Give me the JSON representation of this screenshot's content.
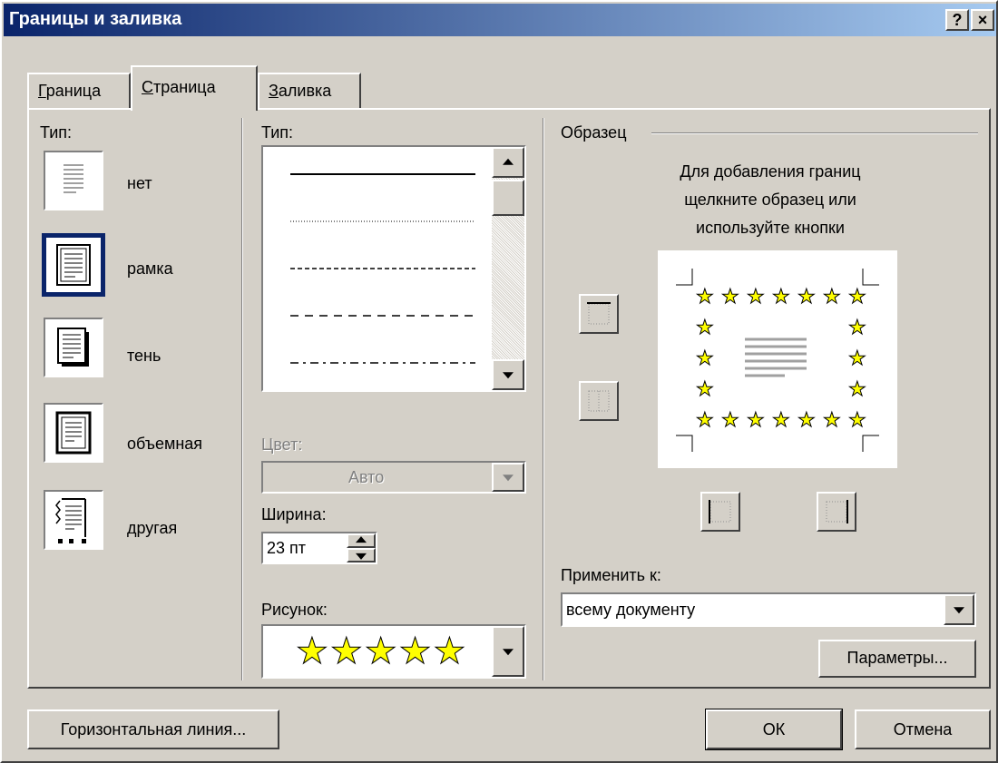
{
  "window": {
    "title": "Границы и заливка",
    "help_label": "?",
    "close_label": "×"
  },
  "tabs": [
    {
      "label": "Граница",
      "mnemonic": "Г"
    },
    {
      "label": "Страница",
      "mnemonic": "С"
    },
    {
      "label": "Заливка",
      "mnemonic": "З"
    }
  ],
  "setting": {
    "header": "Тип:",
    "items": [
      {
        "label": "нет"
      },
      {
        "label": "рамка"
      },
      {
        "label": "тень"
      },
      {
        "label": "объемная"
      },
      {
        "label": "другая"
      }
    ]
  },
  "style": {
    "header": "Тип:",
    "color_label": "Цвет:",
    "color_value": "Авто",
    "width_label": "Ширина:",
    "width_value": "23 пт",
    "art_label": "Рисунок:",
    "art_value": "★★★★★"
  },
  "preview": {
    "header": "Образец",
    "hint": [
      "Для добавления границ",
      "щелкните образец или",
      "используйте кнопки"
    ],
    "star_glyph": "★",
    "apply_label": "Применить к:",
    "apply_value": "всему документу",
    "options_label": "Параметры..."
  },
  "footer": {
    "horizontal_line_label": "Горизонтальная линия...",
    "ok_label": "ОК",
    "cancel_label": "Отмена"
  },
  "colors": {
    "title_start": "#0a246a",
    "title_end": "#a6caf0",
    "face": "#d4d0c8",
    "star": "#ffff00"
  }
}
